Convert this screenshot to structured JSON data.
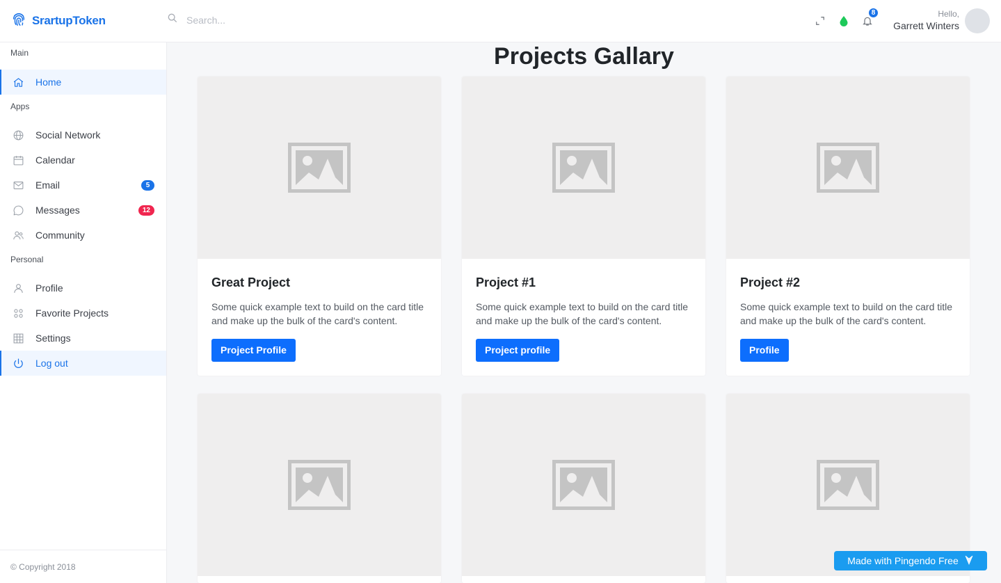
{
  "brand": {
    "name": "SrartupToken",
    "icon": "fingerprint-icon"
  },
  "search": {
    "placeholder": "Search..."
  },
  "header": {
    "notifications_count": "8",
    "status_color": "#1ec95a",
    "greeting": "Hello,",
    "user_name": "Garrett Winters"
  },
  "sidebar": {
    "sections": [
      {
        "title": "Main"
      },
      {
        "title": "Apps"
      },
      {
        "title": "Personal"
      }
    ],
    "main_items": [
      {
        "label": "Home",
        "icon": "home-icon",
        "active": true
      }
    ],
    "app_items": [
      {
        "label": "Social Network",
        "icon": "globe-icon"
      },
      {
        "label": "Calendar",
        "icon": "calendar-icon"
      },
      {
        "label": "Email",
        "icon": "mail-icon",
        "badge": "5",
        "badge_color": "#1a73e8"
      },
      {
        "label": "Messages",
        "icon": "chat-icon",
        "badge": "12",
        "badge_color": "#f0264f"
      },
      {
        "label": "Community",
        "icon": "users-icon"
      }
    ],
    "personal_items": [
      {
        "label": "Profile",
        "icon": "user-icon"
      },
      {
        "label": "Favorite Projects",
        "icon": "apps-icon"
      },
      {
        "label": "Settings",
        "icon": "grid-icon"
      },
      {
        "label": "Log out",
        "icon": "power-icon",
        "active": true
      }
    ],
    "footer": "© Copyright 2018"
  },
  "main": {
    "title": "Projects Gallary",
    "cards": [
      {
        "title": "Great Project",
        "text": "Some quick example text to build on the card title and make up the bulk of the card's content.",
        "button": "Project Profile"
      },
      {
        "title": "Project #1",
        "text": "Some quick example text to build on the card title and make up the bulk of the card's content.",
        "button": "Project profile"
      },
      {
        "title": "Project #2",
        "text": "Some quick example text to build on the card title and make up the bulk of the card's content.",
        "button": "Profile"
      }
    ]
  },
  "pingendo": {
    "label": "Made with Pingendo Free"
  },
  "colors": {
    "accent": "#1a73e8",
    "button": "#0d6efd",
    "placeholder_bg": "#efeeee"
  }
}
